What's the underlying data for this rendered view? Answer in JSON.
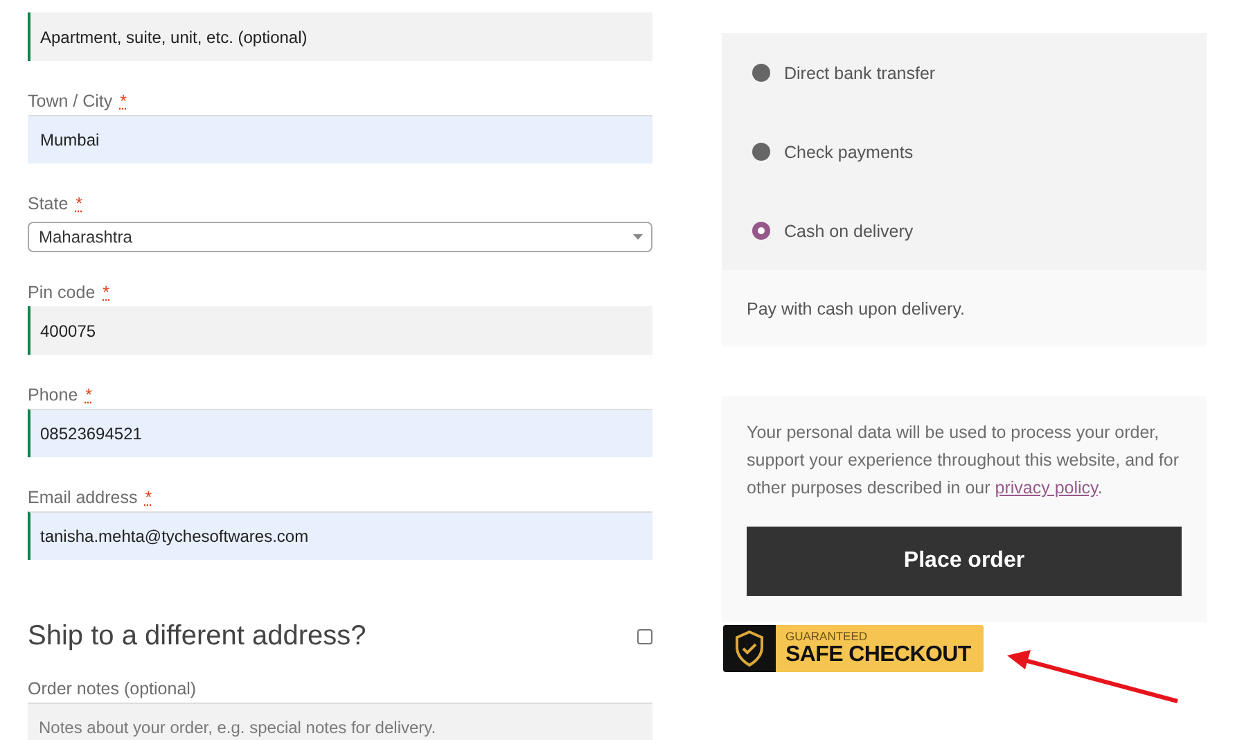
{
  "billing_fields": [
    {
      "kind": "input",
      "placeholder": "Apartment, suite, unit, etc. (optional)",
      "autofilled": false,
      "validated": true
    },
    {
      "kind": "input",
      "label": "Town / City",
      "required_mark": "*",
      "value": "Mumbai",
      "autofilled": true,
      "validated": false
    },
    {
      "kind": "select",
      "label": "State",
      "required_mark": "*",
      "value": "Maharashtra"
    },
    {
      "kind": "input",
      "label": "Pin code",
      "required_mark": "*",
      "value": "400075",
      "autofilled": false,
      "validated": true
    },
    {
      "kind": "input",
      "label": "Phone",
      "required_mark": "*",
      "value": "08523694521",
      "autofilled": true,
      "validated": true
    },
    {
      "kind": "input",
      "label": "Email address",
      "required_mark": "*",
      "value": "tanisha.mehta@tychesoftwares.com",
      "autofilled": true,
      "validated": true
    }
  ],
  "ship_different": {
    "label": "Ship to a different address?",
    "checked": false
  },
  "order_notes": {
    "label": "Order notes (optional)",
    "placeholder": "Notes about your order, e.g. special notes for delivery."
  },
  "payment_methods": [
    {
      "label": "Direct bank transfer",
      "selected": false
    },
    {
      "label": "Check payments",
      "selected": false
    },
    {
      "label": "Cash on delivery",
      "selected": true
    }
  ],
  "payment_description": "Pay with cash upon delivery.",
  "privacy": {
    "text": "Your personal data will be used to process your order, support your experience throughout this website, and for other purposes described in our ",
    "link": "privacy policy",
    "after": "."
  },
  "place_order_button": "Place order",
  "badge": {
    "top": "GUARANTEED",
    "bottom": "SAFE CHECKOUT"
  }
}
